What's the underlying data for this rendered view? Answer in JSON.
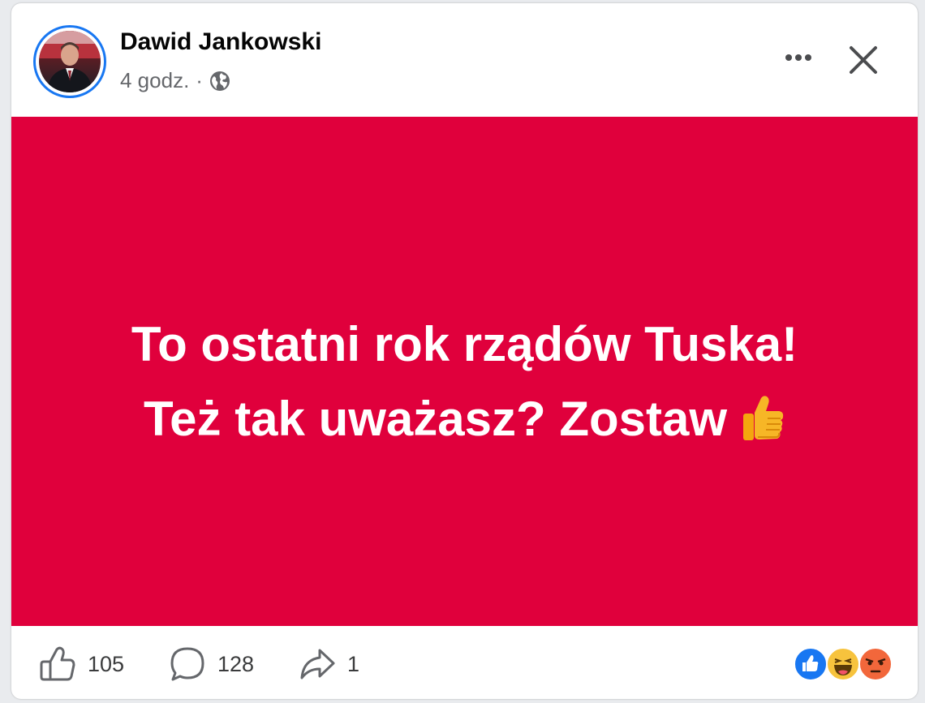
{
  "post": {
    "author": "Dawid Jankowski",
    "time": "4 godz.",
    "separator": "·",
    "line1": "To ostatni rok rządów Tuska!",
    "line2": "Też tak uważasz? Zostaw",
    "background_color": "#e0003c"
  },
  "footer": {
    "likes": "105",
    "comments": "128",
    "shares": "1"
  },
  "icons": [
    "globe-icon",
    "more-icon",
    "close-icon",
    "like-icon",
    "comment-icon",
    "share-icon",
    "thumbs-up-emoji",
    "reaction-like-icon",
    "reaction-haha-icon",
    "reaction-angry-icon"
  ]
}
